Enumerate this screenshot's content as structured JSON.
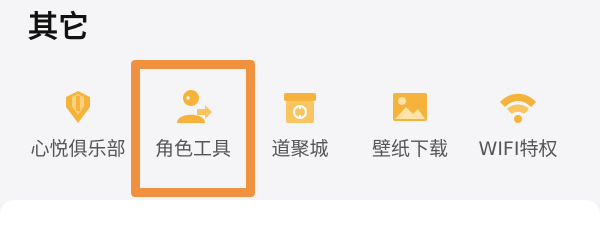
{
  "section": {
    "title": "其它"
  },
  "items": [
    {
      "label": "心悦俱乐部",
      "icon": "diamond-club-icon"
    },
    {
      "label": "角色工具",
      "icon": "role-tool-icon"
    },
    {
      "label": "道聚城",
      "icon": "store-icon"
    },
    {
      "label": "壁纸下载",
      "icon": "wallpaper-icon"
    },
    {
      "label": "WIFI特权",
      "icon": "wifi-icon"
    }
  ],
  "colors": {
    "accent": "#f6b33b",
    "highlight_border": "#f0913f",
    "label_text": "#555555",
    "title_text": "#111111"
  }
}
